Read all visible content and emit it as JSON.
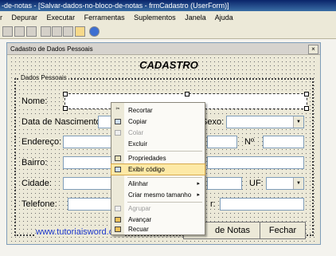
{
  "ide": {
    "title": "-de-notas - [Salvar-dados-no-bloco-de-notas - frmCadastro (UserForm)]",
    "menu": [
      {
        "key": "r",
        "label": "r"
      },
      {
        "key": "D",
        "label": "Depurar"
      },
      {
        "key": "E",
        "label": "Executar"
      },
      {
        "key": "F",
        "label": "Ferramentas"
      },
      {
        "key": "S",
        "label": "Suplementos"
      },
      {
        "key": "J",
        "label": "Janela"
      },
      {
        "key": "A",
        "label": "Ajuda"
      }
    ]
  },
  "form": {
    "caption": "Cadastro de Dados Pessoais",
    "close_glyph": "×",
    "header": "CADASTRO",
    "frame_label": "Dados Pessoais",
    "labels": {
      "nome": "Nome:",
      "nascimento": "Data de Nascimento:",
      "sexo": "Sexo:",
      "endereco": "Endereço:",
      "numero": "Nº",
      "bairro": "Bairro:",
      "cidade": "Cidade:",
      "uf": "UF:",
      "telefone": "Telefone:",
      "partial": "r:"
    },
    "link": "www.tutoriaisword.com",
    "buttons": {
      "notas": "de Notas",
      "fechar": "Fechar"
    }
  },
  "context_menu": {
    "items": [
      {
        "label": "Recortar",
        "icon": "scissors-icon",
        "enabled": true
      },
      {
        "label": "Copiar",
        "icon": "copy-icon",
        "enabled": true
      },
      {
        "label": "Colar",
        "icon": "paste-icon",
        "enabled": false
      },
      {
        "label": "Excluir",
        "icon": "",
        "enabled": true
      },
      {
        "label": "Propriedades",
        "icon": "properties-icon",
        "enabled": true
      },
      {
        "label": "Exibir código",
        "icon": "view-code-icon",
        "enabled": true,
        "highlighted": true
      },
      {
        "label": "Alinhar",
        "icon": "",
        "enabled": true,
        "submenu": true
      },
      {
        "label": "Criar mesmo tamanho",
        "icon": "",
        "enabled": true,
        "submenu": true
      },
      {
        "label": "Agrupar",
        "icon": "group-icon",
        "enabled": false
      },
      {
        "label": "Avançar",
        "icon": "bring-forward-icon",
        "enabled": true
      },
      {
        "label": "Recuar",
        "icon": "send-backward-icon",
        "enabled": true
      }
    ],
    "submenu_glyph": "▸"
  },
  "colors": {
    "accent_highlight": "#fde9a6",
    "link": "#1a35cc"
  }
}
